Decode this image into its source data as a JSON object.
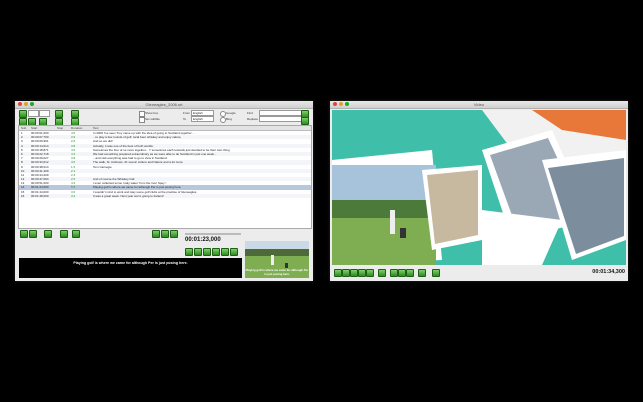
{
  "left_window": {
    "title": "Gleneagles_2006.srt",
    "options": {
      "show_box": "Show box",
      "set_subtitle": "Set subtitle",
      "from_label": "From",
      "from_value": "English",
      "to_label": "To",
      "to_value": "English",
      "engine": "Google",
      "bing": "Bing",
      "find_label": "Find",
      "replace_label": "Replace"
    },
    "columns": [
      "Sub",
      "Start",
      "Stop",
      "Duration",
      "Text"
    ],
    "rows": [
      {
        "n": "1",
        "start": "00:00:01,600",
        "dur": "4.5",
        "text": "In 2006 I've seen Troy came up with the idea of going to Scotland together ..."
      },
      {
        "n": "2",
        "start": "00:00:07,700",
        "dur": "3.9",
        "text": "...to play a few rounds of golf, local beer whiskey and enjoy nature"
      },
      {
        "n": "3",
        "start": "00:00:09,901",
        "dur": "2.0",
        "text": "And so we did!"
      },
      {
        "n": "4",
        "start": "00:00:14,614",
        "dur": "3.8",
        "text": "Actually, it was one of the best of both worlds."
      },
      {
        "n": "5",
        "start": "00:00:18,871",
        "dur": "4.5",
        "text": "Sometimes the four of us more together... Y sometimes each towards just decided to be their own thing"
      },
      {
        "n": "6",
        "start": "00:00:22,718",
        "dur": "4.3",
        "text": "We had something prepared extraordinary as we were able to do Scotland in just one week..."
      },
      {
        "n": "7",
        "start": "00:00:29,027",
        "dur": "3.8",
        "text": "...and visit everything was had to go to view in Scotland."
      },
      {
        "n": "8",
        "start": "00:00:33,612",
        "dur": "4.5",
        "text": "The walk, St. Andrews, 21 scenic culture and Nature and a lot more."
      },
      {
        "n": "9",
        "start": "00:00:38,014",
        "dur": "1.5",
        "text": "Tom Carnegie"
      },
      {
        "n": "10",
        "start": "00:00:41,309",
        "dur": "2.1",
        "text": ""
      },
      {
        "n": "11",
        "start": "00:00:44,209",
        "dur": "2.3",
        "text": ""
      },
      {
        "n": "12",
        "start": "00:00:47,094",
        "dur": "2.5",
        "text": "And of course the Whiskey trail"
      },
      {
        "n": "13",
        "start": "00:00:51,000",
        "dur": "4.3",
        "text": "I even collected some 'naky water' from the river Spey !"
      },
      {
        "n": "14",
        "start": "00:01:23,000",
        "dur": "5.5",
        "text": "Playing golf is where we came for although Per is just posing here.",
        "selected": true
      },
      {
        "n": "15",
        "start": "00:01:44,000",
        "dur": "3.6",
        "text": "I wouldn't mind to work and stay some golf clubs at the practise of Gleneagles."
      },
      {
        "n": "16",
        "start": "00:01:48,000",
        "dur": "3.2",
        "text": "It was a great week. Next year we're going to Ireland!"
      }
    ],
    "timecode": "00:01:23,000",
    "subtitle_text": "Playing golf is where we came for although Per is just posing here.",
    "thumb_subtitle": "Playing golf is where we came for although Per is just posing here."
  },
  "right_window": {
    "title": "Video",
    "timecode": "00:01:34,300"
  }
}
